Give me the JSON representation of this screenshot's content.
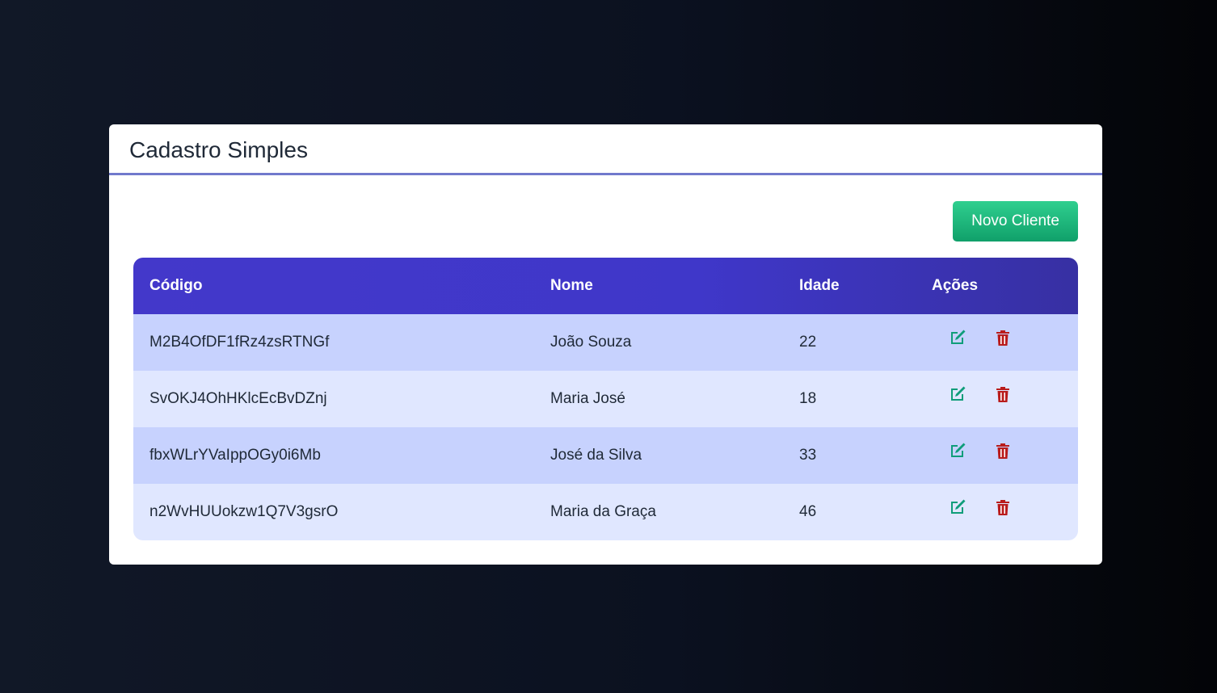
{
  "app": {
    "title": "Cadastro Simples"
  },
  "toolbar": {
    "new_label": "Novo Cliente"
  },
  "table": {
    "headers": [
      "Código",
      "Nome",
      "Idade",
      "Ações"
    ],
    "rows": [
      {
        "codigo": "M2B4OfDF1fRz4zsRTNGf",
        "nome": "João Souza",
        "idade": "22"
      },
      {
        "codigo": "SvOKJ4OhHKlcEcBvDZnj",
        "nome": "Maria José",
        "idade": "18"
      },
      {
        "codigo": "fbxWLrYVaIppOGy0i6Mb",
        "nome": "José da Silva",
        "idade": "33"
      },
      {
        "codigo": "n2WvHUUokzw1Q7V3gsrO",
        "nome": "Maria da Graça",
        "idade": "46"
      }
    ],
    "row_actions": [
      "edit-icon",
      "trash-icon"
    ]
  },
  "colors": {
    "header_accent": "#4338ca",
    "button": "#10b981",
    "edit_icon": "#0f9d7a",
    "delete_icon": "#b91c1c",
    "row_odd": "#c7d2fe",
    "row_even": "#e0e7ff"
  }
}
